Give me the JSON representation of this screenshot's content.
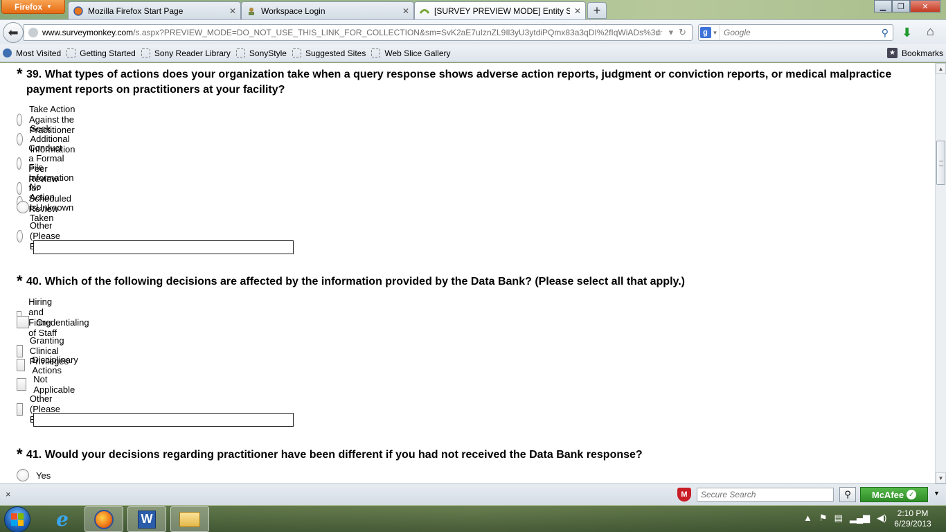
{
  "browser": {
    "menu_button": "Firefox",
    "tabs": [
      {
        "title": "Mozilla Firefox Start Page",
        "icon": "firefox-icon",
        "active": false
      },
      {
        "title": "Workspace Login",
        "icon": "workspace-icon",
        "active": false
      },
      {
        "title": "[SURVEY PREVIEW MODE] Entity Surv...",
        "icon": "surveymonkey-icon",
        "active": true
      }
    ],
    "new_tab": "+",
    "url_host": "www.surveymonkey.com",
    "url_path": "/s.aspx?PREVIEW_MODE=DO_NOT_USE_THIS_LINK_FOR_COLLECTION&sm=SvK2aE7uIznZL9Il3yU3ytdiPQmx83a3qDI%2fIqWiADs%3d",
    "search_placeholder": "Google",
    "bookmarks": [
      "Most Visited",
      "Getting Started",
      "Sony Reader Library",
      "SonyStyle",
      "Suggested Sites",
      "Web Slice Gallery"
    ],
    "bookmarks_menu": "Bookmarks"
  },
  "survey": {
    "q39": {
      "required_mark": "*",
      "text": "39. What types of actions does your organization take when a query response shows adverse action reports, judgment or conviction reports, or medical malpractice payment reports on practitioners at your facility?",
      "input_type": "radio",
      "options": [
        "Take Action Against the Practitioner",
        "Seek Additional Information",
        "Conduct a Formal Peer Review",
        "File Information for Scheduled Review",
        "No Action Is Taken",
        "Unknown",
        "Other (Please Explain)"
      ],
      "other_value": ""
    },
    "q40": {
      "required_mark": "*",
      "text": "40. Which of the following decisions are affected by the information provided by the Data Bank? (Please select all that apply.)",
      "input_type": "checkbox",
      "options": [
        "Hiring and Firing of Staff",
        "Credentialing",
        "Granting Clinical Privileges",
        "Disciplinary Actions",
        "Not Applicable",
        "Other (Please Explain)"
      ],
      "other_value": ""
    },
    "q41": {
      "required_mark": "*",
      "text": "41. Would your decisions regarding practitioner have been different if you had not received the Data Bank response?",
      "input_type": "radio",
      "options": [
        "Yes"
      ]
    }
  },
  "addon_bar": {
    "close": "×",
    "secure_search_placeholder": "Secure Search",
    "mcafee_label": "McAfee"
  },
  "taskbar": {
    "time": "2:10 PM",
    "date": "6/29/2013"
  }
}
